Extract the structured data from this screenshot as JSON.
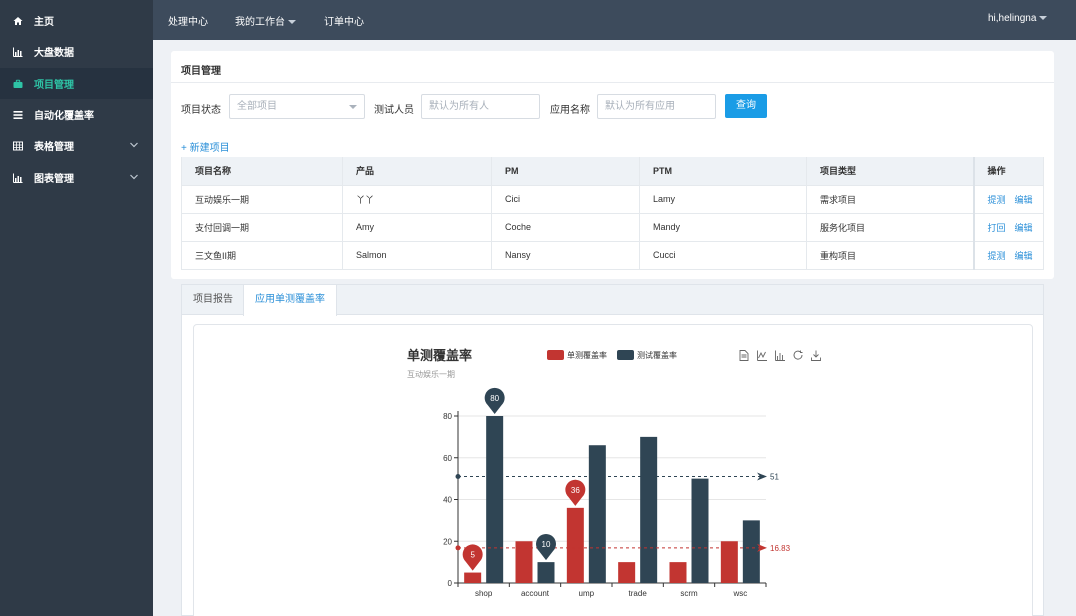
{
  "sidebar": {
    "items": [
      {
        "label": "主页",
        "icon": "home-icon"
      },
      {
        "label": "大盘数据",
        "icon": "bar-chart-icon"
      },
      {
        "label": "项目管理",
        "icon": "briefcase-icon",
        "active": true
      },
      {
        "label": "自动化覆盖率",
        "icon": "list-icon"
      },
      {
        "label": "表格管理",
        "icon": "table-icon",
        "expandable": true
      },
      {
        "label": "图表管理",
        "icon": "bar-chart-icon",
        "expandable": true
      }
    ]
  },
  "topbar": {
    "links": [
      "处理中心",
      "我的工作台",
      "订单中心"
    ],
    "user": "hi,helingna"
  },
  "panel": {
    "title": "项目管理",
    "filters": {
      "status_label": "项目状态",
      "status_value": "全部项目",
      "tester_label": "测试人员",
      "tester_placeholder": "默认为所有人",
      "app_label": "应用名称",
      "app_placeholder": "默认为所有应用",
      "query_button": "查询"
    },
    "new_link": "+ 新建项目",
    "table": {
      "headers": [
        "项目名称",
        "产品",
        "PM",
        "PTM",
        "项目类型",
        "操作"
      ],
      "rows": [
        {
          "cells": [
            "互动娱乐一期",
            "丫丫",
            "Cici",
            "Lamy",
            "需求项目"
          ],
          "actions": [
            "提测",
            "编辑"
          ]
        },
        {
          "cells": [
            "支付回调一期",
            "Amy",
            "Coche",
            "Mandy",
            "服务化项目"
          ],
          "actions": [
            "打回",
            "编辑"
          ]
        },
        {
          "cells": [
            "三文鱼II期",
            "Salmon",
            "Nansy",
            "Cucci",
            "重构项目"
          ],
          "actions": [
            "提测",
            "编辑"
          ]
        }
      ]
    }
  },
  "tabs": [
    "项目报告",
    "应用单测覆盖率"
  ],
  "colors": {
    "red": "#c23531",
    "navy": "#2f4554",
    "accent": "#1a9ce6",
    "green": "#2ec4a6"
  },
  "chart_data": {
    "type": "bar",
    "title": "单测覆盖率",
    "subtitle": "互动娱乐一期",
    "categories": [
      "shop",
      "account",
      "ump",
      "trade",
      "scrm",
      "wsc"
    ],
    "series": [
      {
        "name": "单测覆盖率",
        "color": "#c23531",
        "values": [
          5,
          20,
          36,
          10,
          10,
          20
        ]
      },
      {
        "name": "测试覆盖率",
        "color": "#2f4554",
        "values": [
          80,
          10,
          66,
          70,
          50,
          30
        ]
      }
    ],
    "ylim": [
      0,
      80
    ],
    "yticks": [
      0,
      20,
      40,
      60,
      80
    ],
    "markpoints": [
      {
        "series": 0,
        "category": "shop",
        "value": 5
      },
      {
        "series": 0,
        "category": "ump",
        "value": 36
      },
      {
        "series": 1,
        "category": "shop",
        "value": 80
      },
      {
        "series": 1,
        "category": "account",
        "value": 10
      }
    ],
    "marklines": [
      {
        "series": 1,
        "value": 51,
        "label": "51"
      },
      {
        "series": 0,
        "value": 16.83,
        "label": "16.83"
      }
    ],
    "grid": true,
    "legend_position": "top",
    "toolbox": [
      "data-view-icon",
      "line-chart-icon",
      "bar-chart-icon",
      "refresh-icon",
      "download-icon"
    ]
  }
}
